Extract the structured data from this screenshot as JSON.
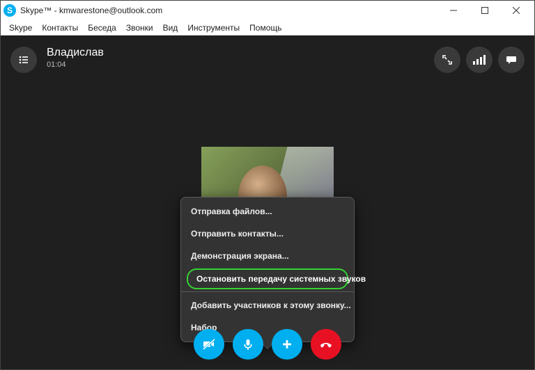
{
  "window": {
    "title": "Skype™ - kmwarestone@outlook.com"
  },
  "menu": {
    "skype": "Skype",
    "contacts": "Контакты",
    "conversation": "Беседа",
    "calls": "Звонки",
    "view": "Вид",
    "tools": "Инструменты",
    "help": "Помощь"
  },
  "call": {
    "contact_name": "Владислав",
    "duration": "01:04"
  },
  "popup": {
    "send_files": "Отправка файлов...",
    "send_contacts": "Отправить контакты...",
    "share_screen": "Демонстрация экрана...",
    "stop_system_sounds": "Остановить передачу системных звуков",
    "add_participants": "Добавить участников к этому звонку...",
    "dialpad": "Набор"
  },
  "icons": {
    "list": "list-icon",
    "expand": "expand-icon",
    "signal": "signal-icon",
    "chat": "chat-icon",
    "camera_off": "camera-off-icon",
    "mic": "mic-icon",
    "plus": "plus-icon",
    "hangup": "hangup-icon"
  },
  "colors": {
    "accent": "#00aff0",
    "danger": "#e81123",
    "highlight": "#34d334",
    "background_dark": "#1f1f1f"
  }
}
